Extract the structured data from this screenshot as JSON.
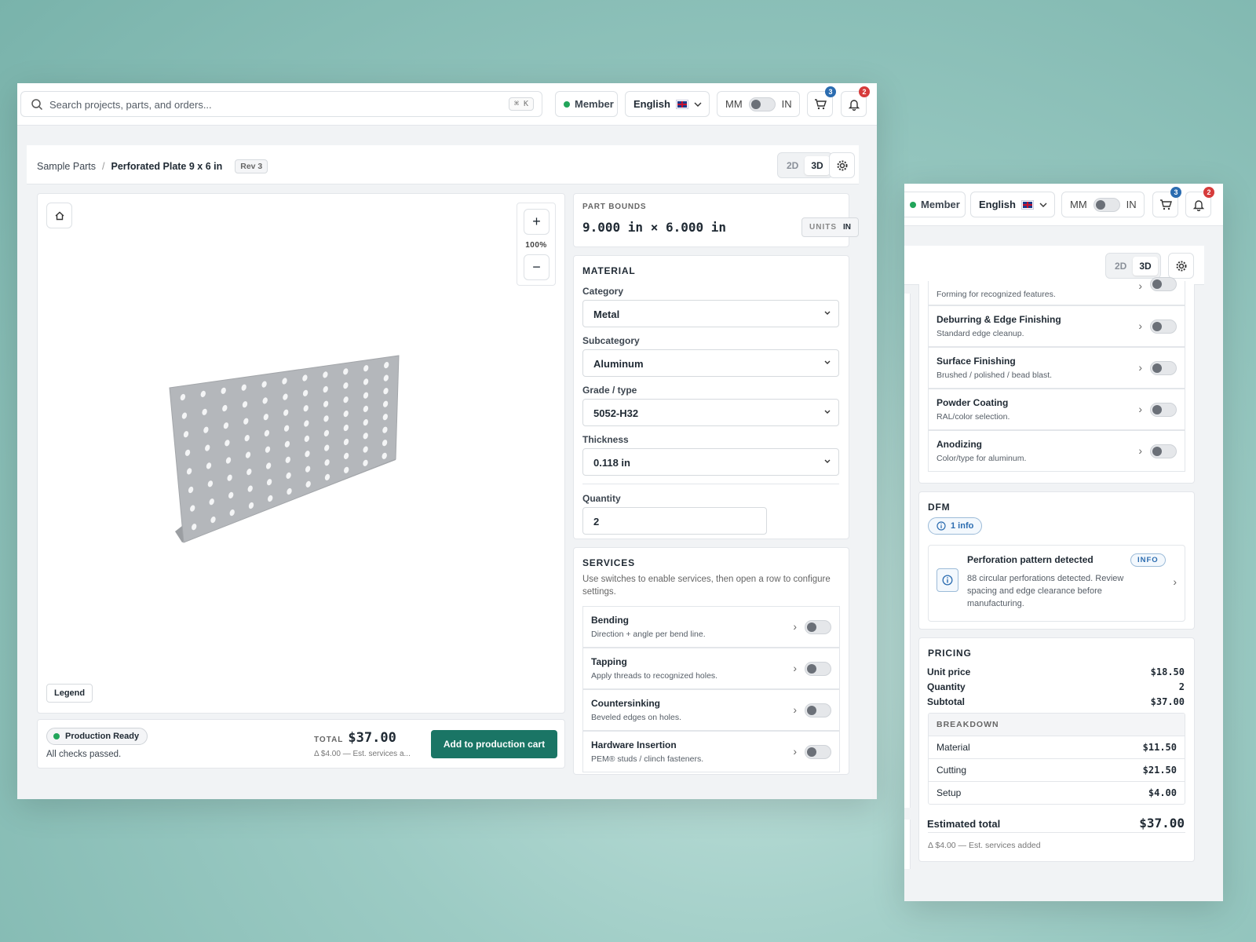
{
  "search": {
    "placeholder": "Search projects, parts, and orders...",
    "shortcut": "⌘ K"
  },
  "header": {
    "member_label": "Member",
    "language": "English",
    "unit_left": "MM",
    "unit_right": "IN",
    "cart_count": "3",
    "notif_count": "2"
  },
  "breadcrumb": {
    "parent": "Sample Parts",
    "separator": "/",
    "current": "Perforated Plate 9 x 6 in",
    "rev": "Rev 3"
  },
  "view_toggle": {
    "option_2d": "2D",
    "option_3d": "3D",
    "active": "3D"
  },
  "viewer": {
    "zoom": "100%",
    "legend": "Legend",
    "zoom_in": "+",
    "zoom_out": "−"
  },
  "status": {
    "badge": "Production Ready",
    "note": "All checks passed."
  },
  "total": {
    "label": "TOTAL",
    "value": "$37.00",
    "delta": "Δ $4.00 — Est. services a...",
    "cta": "Add to production cart"
  },
  "part_bounds": {
    "title": "PART BOUNDS",
    "value": "9.000 in × 6.000 in",
    "units_label": "UNITS",
    "units_value": "IN"
  },
  "material": {
    "title": "MATERIAL",
    "category_label": "Category",
    "category": "Metal",
    "subcategory_label": "Subcategory",
    "subcategory": "Aluminum",
    "grade_label": "Grade / type",
    "grade": "5052-H32",
    "thickness_label": "Thickness",
    "thickness": "0.118 in",
    "quantity_label": "Quantity",
    "quantity": "2"
  },
  "services": {
    "title": "SERVICES",
    "hint": "Use switches to enable services, then open a row to configure settings.",
    "items": [
      {
        "title": "Bending",
        "desc": "Direction + angle per bend line."
      },
      {
        "title": "Tapping",
        "desc": "Apply threads to recognized holes."
      },
      {
        "title": "Countersinking",
        "desc": "Beveled edges on holes."
      },
      {
        "title": "Hardware Insertion",
        "desc": "PEM® studs / clinch fasteners."
      }
    ],
    "side_items": [
      {
        "title": "",
        "desc": "Forming for recognized features."
      },
      {
        "title": "Deburring & Edge Finishing",
        "desc": "Standard edge cleanup."
      },
      {
        "title": "Surface Finishing",
        "desc": "Brushed / polished / bead blast."
      },
      {
        "title": "Powder Coating",
        "desc": "RAL/color selection."
      },
      {
        "title": "Anodizing",
        "desc": "Color/type for aluminum."
      }
    ]
  },
  "dfm": {
    "title": "DFM",
    "summary": "1 info",
    "item_title": "Perforation pattern detected",
    "item_badge": "INFO",
    "item_desc": "88 circular perforations detected. Review spacing and edge clearance before manufacturing."
  },
  "pricing": {
    "title": "PRICING",
    "unit_price_label": "Unit price",
    "unit_price": "$18.50",
    "quantity_label": "Quantity",
    "quantity": "2",
    "subtotal_label": "Subtotal",
    "subtotal": "$37.00",
    "breakdown_title": "BREAKDOWN",
    "breakdown": [
      {
        "label": "Material",
        "value": "$11.50"
      },
      {
        "label": "Cutting",
        "value": "$21.50"
      },
      {
        "label": "Setup",
        "value": "$4.00"
      }
    ],
    "estimated_label": "Estimated total",
    "estimated": "$37.00",
    "delta_note": "Δ $4.00 — Est. services added"
  },
  "colors": {
    "accent": "#1a7565",
    "badge_blue": "#2b6cb0",
    "badge_red": "#d63b3b",
    "ready_green": "#22a55a"
  }
}
